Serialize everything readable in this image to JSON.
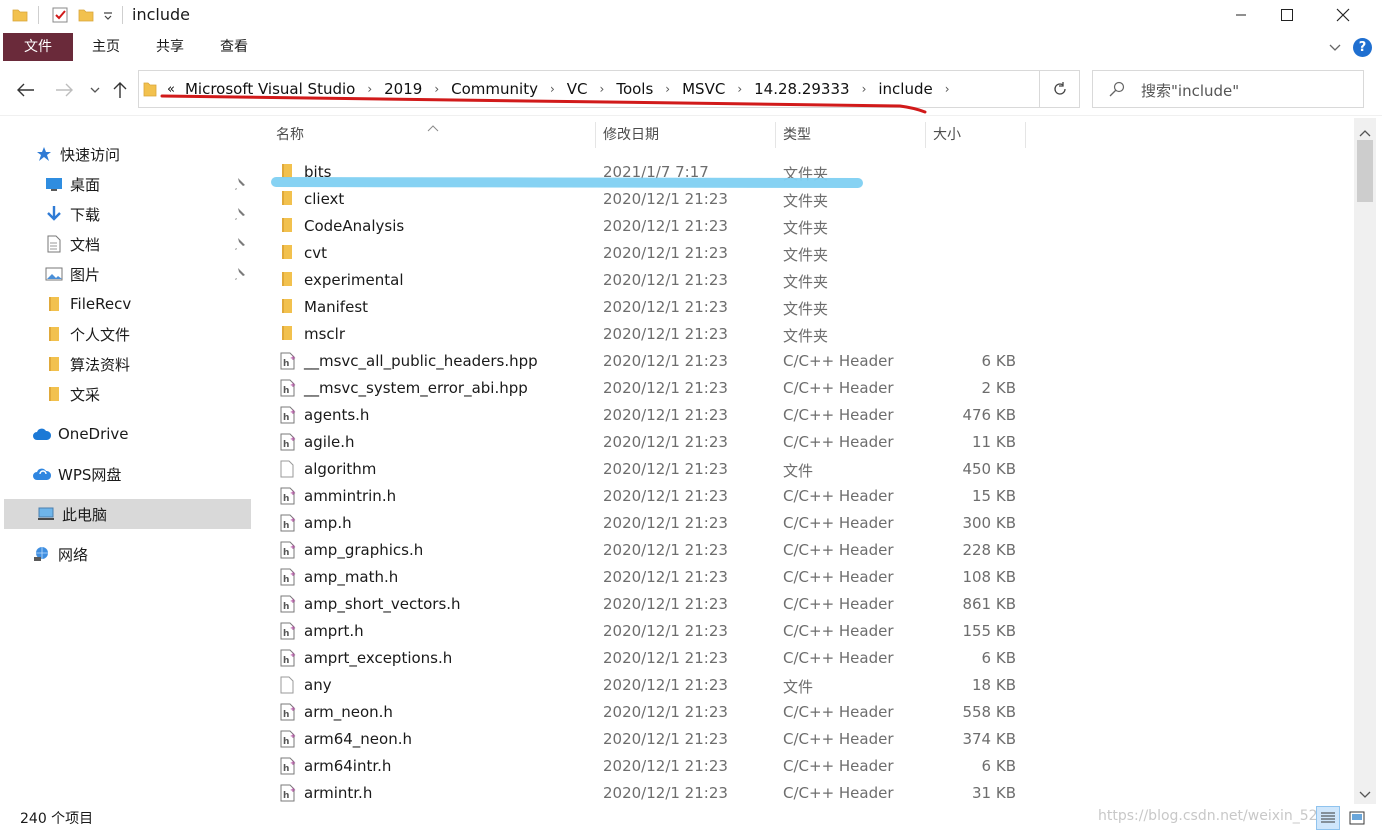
{
  "window": {
    "title": "include"
  },
  "ribbon": {
    "tabs": [
      "文件",
      "主页",
      "共享",
      "查看"
    ],
    "help_label": "?"
  },
  "address": {
    "overflow": "«",
    "crumbs": [
      "Microsoft Visual Studio",
      "2019",
      "Community",
      "VC",
      "Tools",
      "MSVC",
      "14.28.29333",
      "include"
    ],
    "search_placeholder": "搜索\"include\""
  },
  "sidebar": {
    "items": [
      {
        "label": "快速访问",
        "icon": "star-icon"
      },
      {
        "label": "桌面",
        "icon": "desktop-icon",
        "pinned": true
      },
      {
        "label": "下载",
        "icon": "download-icon",
        "pinned": true
      },
      {
        "label": "文档",
        "icon": "document-icon",
        "pinned": true
      },
      {
        "label": "图片",
        "icon": "picture-icon",
        "pinned": true
      },
      {
        "label": "FileRecv",
        "icon": "folder-icon"
      },
      {
        "label": "个人文件",
        "icon": "folder-icon"
      },
      {
        "label": "算法资料",
        "icon": "folder-icon"
      },
      {
        "label": "文采",
        "icon": "folder-icon"
      },
      {
        "label": "OneDrive",
        "icon": "cloud-icon"
      },
      {
        "label": "WPS网盘",
        "icon": "wps-cloud-icon"
      },
      {
        "label": "此电脑",
        "icon": "computer-icon",
        "selected": true
      },
      {
        "label": "网络",
        "icon": "network-icon"
      }
    ]
  },
  "columns": {
    "name": "名称",
    "date": "修改日期",
    "type": "类型",
    "size": "大小"
  },
  "files": [
    {
      "name": "bits",
      "date": "2021/1/7 7:17",
      "type": "文件夹",
      "size": "",
      "kind": "folder"
    },
    {
      "name": "cliext",
      "date": "2020/12/1 21:23",
      "type": "文件夹",
      "size": "",
      "kind": "folder"
    },
    {
      "name": "CodeAnalysis",
      "date": "2020/12/1 21:23",
      "type": "文件夹",
      "size": "",
      "kind": "folder"
    },
    {
      "name": "cvt",
      "date": "2020/12/1 21:23",
      "type": "文件夹",
      "size": "",
      "kind": "folder"
    },
    {
      "name": "experimental",
      "date": "2020/12/1 21:23",
      "type": "文件夹",
      "size": "",
      "kind": "folder"
    },
    {
      "name": "Manifest",
      "date": "2020/12/1 21:23",
      "type": "文件夹",
      "size": "",
      "kind": "folder"
    },
    {
      "name": "msclr",
      "date": "2020/12/1 21:23",
      "type": "文件夹",
      "size": "",
      "kind": "folder"
    },
    {
      "name": "__msvc_all_public_headers.hpp",
      "date": "2020/12/1 21:23",
      "type": "C/C++ Header",
      "size": "6 KB",
      "kind": "header"
    },
    {
      "name": "__msvc_system_error_abi.hpp",
      "date": "2020/12/1 21:23",
      "type": "C/C++ Header",
      "size": "2 KB",
      "kind": "header"
    },
    {
      "name": "agents.h",
      "date": "2020/12/1 21:23",
      "type": "C/C++ Header",
      "size": "476 KB",
      "kind": "header"
    },
    {
      "name": "agile.h",
      "date": "2020/12/1 21:23",
      "type": "C/C++ Header",
      "size": "11 KB",
      "kind": "header"
    },
    {
      "name": "algorithm",
      "date": "2020/12/1 21:23",
      "type": "文件",
      "size": "450 KB",
      "kind": "file"
    },
    {
      "name": "ammintrin.h",
      "date": "2020/12/1 21:23",
      "type": "C/C++ Header",
      "size": "15 KB",
      "kind": "header"
    },
    {
      "name": "amp.h",
      "date": "2020/12/1 21:23",
      "type": "C/C++ Header",
      "size": "300 KB",
      "kind": "header"
    },
    {
      "name": "amp_graphics.h",
      "date": "2020/12/1 21:23",
      "type": "C/C++ Header",
      "size": "228 KB",
      "kind": "header"
    },
    {
      "name": "amp_math.h",
      "date": "2020/12/1 21:23",
      "type": "C/C++ Header",
      "size": "108 KB",
      "kind": "header"
    },
    {
      "name": "amp_short_vectors.h",
      "date": "2020/12/1 21:23",
      "type": "C/C++ Header",
      "size": "861 KB",
      "kind": "header"
    },
    {
      "name": "amprt.h",
      "date": "2020/12/1 21:23",
      "type": "C/C++ Header",
      "size": "155 KB",
      "kind": "header"
    },
    {
      "name": "amprt_exceptions.h",
      "date": "2020/12/1 21:23",
      "type": "C/C++ Header",
      "size": "6 KB",
      "kind": "header"
    },
    {
      "name": "any",
      "date": "2020/12/1 21:23",
      "type": "文件",
      "size": "18 KB",
      "kind": "file"
    },
    {
      "name": "arm_neon.h",
      "date": "2020/12/1 21:23",
      "type": "C/C++ Header",
      "size": "558 KB",
      "kind": "header"
    },
    {
      "name": "arm64_neon.h",
      "date": "2020/12/1 21:23",
      "type": "C/C++ Header",
      "size": "374 KB",
      "kind": "header"
    },
    {
      "name": "arm64intr.h",
      "date": "2020/12/1 21:23",
      "type": "C/C++ Header",
      "size": "6 KB",
      "kind": "header"
    },
    {
      "name": "armintr.h",
      "date": "2020/12/1 21:23",
      "type": "C/C++ Header",
      "size": "31 KB",
      "kind": "header"
    }
  ],
  "status": {
    "item_count": "240 个项目",
    "watermark": "https://blog.csdn.net/weixin_52"
  },
  "colors": {
    "file_tab": "#6a2a3a",
    "folder": "#f2c14e",
    "selected_nav": "#d9d9d9",
    "annot_red": "#d11a1a",
    "annot_blue": "#7fd0f2"
  }
}
